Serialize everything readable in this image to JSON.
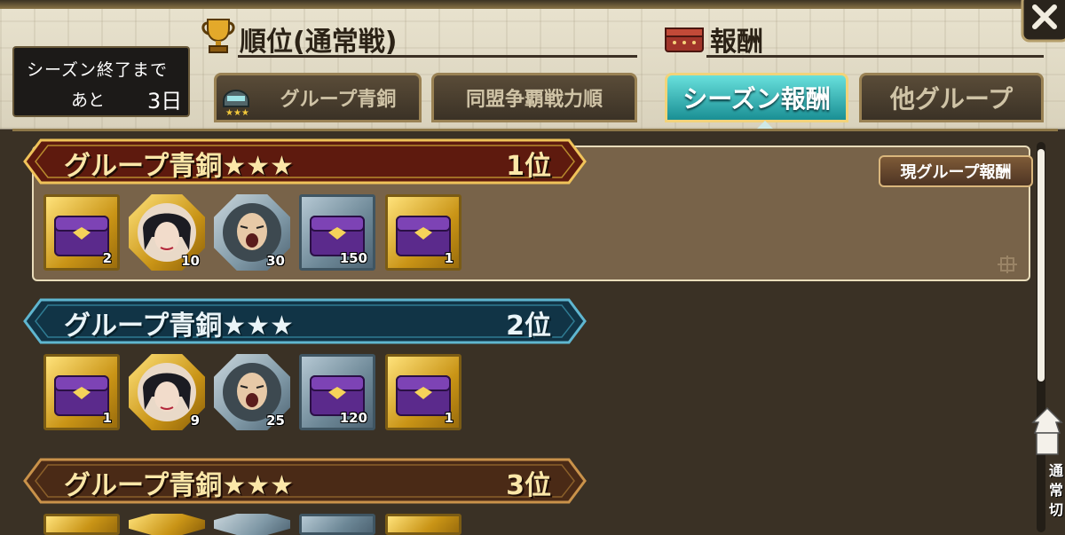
{
  "season": {
    "line1": "シーズン終了まで",
    "prefix": "あと",
    "days": "3日"
  },
  "headers": {
    "ranking": "順位(通常戦)",
    "reward": "報酬"
  },
  "tabs": [
    {
      "label": "グループ青銅",
      "active": false
    },
    {
      "label": "同盟争覇戦力順",
      "active": false
    },
    {
      "label": "シーズン報酬",
      "active": true
    },
    {
      "label": "他グループ",
      "active": false
    }
  ],
  "current_badge": "現グループ報酬",
  "tiers": [
    {
      "title": "グループ青銅★★★",
      "rank": "1位",
      "style": "red",
      "items": [
        {
          "kind": "chest",
          "frame": "gold",
          "qty": "2"
        },
        {
          "kind": "portrait-woman",
          "frame": "gold",
          "qty": "10"
        },
        {
          "kind": "portrait-man",
          "frame": "silver",
          "qty": "30"
        },
        {
          "kind": "chest",
          "frame": "silver",
          "qty": "150"
        },
        {
          "kind": "chest",
          "frame": "gold",
          "qty": "1"
        }
      ]
    },
    {
      "title": "グループ青銅★★★",
      "rank": "2位",
      "style": "blue",
      "items": [
        {
          "kind": "chest",
          "frame": "gold",
          "qty": "1"
        },
        {
          "kind": "portrait-woman",
          "frame": "gold",
          "qty": "9"
        },
        {
          "kind": "portrait-man",
          "frame": "silver",
          "qty": "25"
        },
        {
          "kind": "chest",
          "frame": "silver",
          "qty": "120"
        },
        {
          "kind": "chest",
          "frame": "gold",
          "qty": "1"
        }
      ]
    },
    {
      "title": "グループ青銅★★★",
      "rank": "3位",
      "style": "red",
      "items": []
    }
  ],
  "side_label": "通常切",
  "colors": {
    "gold": "#c99416",
    "teal_tab": "#1a8f94",
    "red_banner": "#5e1a0e",
    "blue_banner": "#113446"
  }
}
